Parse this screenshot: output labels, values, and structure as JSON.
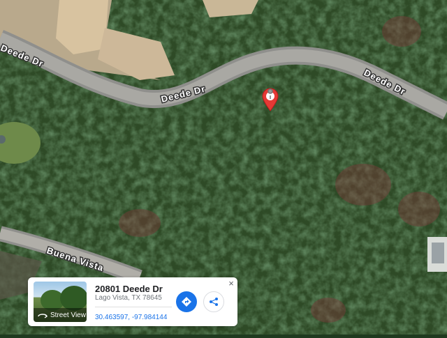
{
  "roads": [
    {
      "label": "Deede Dr",
      "id": "deede-left"
    },
    {
      "label": "Deede Dr",
      "id": "deede-center"
    },
    {
      "label": "Deede Dr",
      "id": "deede-right"
    },
    {
      "label": "Buena Vista",
      "id": "buena-vista"
    }
  ],
  "marker": {
    "icon": "map-pin-icon",
    "color": "#e53935"
  },
  "place_card": {
    "thumbnail_label": "Street View",
    "address": "20801 Deede Dr",
    "city": "Lago Vista, TX 78645",
    "coordinates": "30.463597, -97.984144",
    "directions_icon": "directions-icon",
    "share_icon": "share-icon",
    "close_label": "×",
    "accent_color": "#1a73e8"
  }
}
